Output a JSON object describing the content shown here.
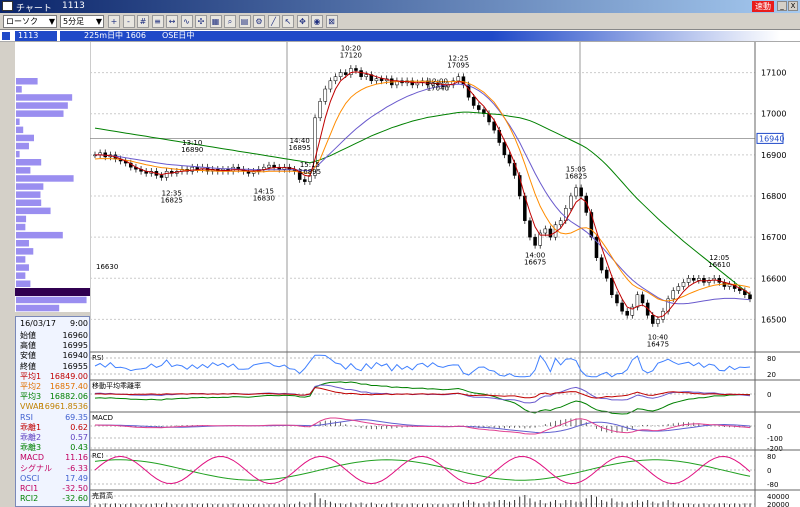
{
  "window": {
    "title": "チャート",
    "code": "1113",
    "fast_badge": "速動",
    "min_btn": "_",
    "close_btn": "X"
  },
  "toolbar": {
    "chart_type": "ローソク",
    "period": "5分足",
    "dropdown_arrow": "▼",
    "tools": [
      {
        "name": "zoom-in",
        "glyph": "+"
      },
      {
        "name": "zoom-out",
        "glyph": "-"
      },
      {
        "name": "grid",
        "glyph": "#"
      },
      {
        "name": "bars",
        "glyph": "≡"
      },
      {
        "name": "fit",
        "glyph": "↔"
      },
      {
        "name": "line-chart",
        "glyph": "∿"
      },
      {
        "name": "scatter",
        "glyph": "✣"
      },
      {
        "name": "table",
        "glyph": "▦"
      },
      {
        "name": "search",
        "glyph": "⌕"
      },
      {
        "name": "analysis",
        "glyph": "▤"
      },
      {
        "name": "settings",
        "glyph": "⚙"
      },
      {
        "name": "draw-line",
        "glyph": "╱"
      },
      {
        "name": "cursor",
        "glyph": "↖"
      },
      {
        "name": "pan",
        "glyph": "✥"
      },
      {
        "name": "find",
        "glyph": "◉"
      },
      {
        "name": "clear",
        "glyph": "⊠"
      }
    ]
  },
  "status": {
    "code": "1113",
    "symbol": "225m日中 1606",
    "market": "OSE日中"
  },
  "info_panel": {
    "date": "16/03/17",
    "time": "9:00",
    "rows": [
      {
        "label": "始値",
        "value": "16960",
        "color": "#000000"
      },
      {
        "label": "高値",
        "value": "16995",
        "color": "#000000"
      },
      {
        "label": "安値",
        "value": "16940",
        "color": "#000000"
      },
      {
        "label": "終値",
        "value": "16955",
        "color": "#000000"
      },
      {
        "label": "平均1",
        "value": "16849.00",
        "color": "#c00000"
      },
      {
        "label": "平均2",
        "value": "16857.40",
        "color": "#e07000"
      },
      {
        "label": "平均3",
        "value": "16882.06",
        "color": "#008000"
      },
      {
        "label": "VWAP",
        "value": "16961.8536",
        "color": "#c08000"
      },
      {
        "label": "RSI",
        "value": "69.35",
        "color": "#4060d0"
      },
      {
        "label": "乖離1",
        "value": "0.62",
        "color": "#c00000"
      },
      {
        "label": "乖離2",
        "value": "0.57",
        "color": "#6040c0"
      },
      {
        "label": "乖離3",
        "value": "0.43",
        "color": "#008000"
      },
      {
        "label": "MACD",
        "value": "11.16",
        "color": "#c00060"
      },
      {
        "label": "シグナル",
        "value": "-6.33",
        "color": "#c00060"
      },
      {
        "label": "OSCI",
        "value": "17.49",
        "color": "#4060d0"
      },
      {
        "label": "RCI1",
        "value": "-32.50",
        "color": "#c00060"
      },
      {
        "label": "RCI2",
        "value": "-32.60",
        "color": "#008000"
      }
    ]
  },
  "vol_profile": {
    "price_marker": "16630",
    "bars": [
      {
        "width": 0.3
      },
      {
        "width": 0.08
      },
      {
        "width": 0.78
      },
      {
        "width": 0.72
      },
      {
        "width": 0.66
      },
      {
        "width": 0.05
      },
      {
        "width": 0.1
      },
      {
        "width": 0.25
      },
      {
        "width": 0.18
      },
      {
        "width": 0.05
      },
      {
        "width": 0.35
      },
      {
        "width": 0.2
      },
      {
        "width": 0.8
      },
      {
        "width": 0.38
      },
      {
        "width": 0.34
      },
      {
        "width": 0.35
      },
      {
        "width": 0.48
      },
      {
        "width": 0.14
      },
      {
        "width": 0.13
      },
      {
        "width": 0.65
      },
      {
        "width": 0.18
      },
      {
        "width": 0.24
      },
      {
        "width": 0.13
      },
      {
        "width": 0.18
      },
      {
        "width": 0.13
      },
      {
        "width": 0.2
      },
      {
        "width": 0.98
      },
      {
        "width": 0.98
      },
      {
        "width": 0.6
      }
    ]
  },
  "colors": {
    "ma1": "#c00000",
    "ma2": "#ff8c00",
    "ma3": "#008000",
    "vwap": "#6a5acd",
    "candle_up": "#ffffff",
    "candle_down": "#000000",
    "rsi": "#4080ff",
    "macd": "#e04090",
    "signal": "#6060d0",
    "rci1": "#e01080",
    "rci2": "#20a020"
  },
  "price_axis": {
    "ticks": [
      "17100",
      "17000",
      "16900",
      "16800",
      "16700",
      "16600",
      "16500"
    ],
    "current": "16940"
  },
  "sub_panels": {
    "rsi": {
      "label": "RSI",
      "ticks": [
        "80",
        "20"
      ]
    },
    "dev": {
      "label": "移動平均乖離率",
      "ticks": [
        "0"
      ]
    },
    "macd": {
      "label": "MACD",
      "ticks": [
        "0",
        "-100",
        "-200"
      ]
    },
    "rci": {
      "label": "RCI",
      "ticks": [
        "80",
        "0",
        "-80"
      ]
    },
    "vol": {
      "label": "売買高",
      "ticks": [
        "40000",
        "20000"
      ]
    }
  },
  "chart_data": {
    "type": "candlestick",
    "ylim": [
      16450,
      17150
    ],
    "annotations": [
      {
        "time": "13:10",
        "price": "16890"
      },
      {
        "time": "12:35",
        "price": "16825"
      },
      {
        "time": "14:15",
        "price": "16830"
      },
      {
        "time": "14:40",
        "price": "16895"
      },
      {
        "time": "15:15",
        "price": "16895"
      },
      {
        "time": "10:20",
        "price": "17120"
      },
      {
        "time": "12:25",
        "price": "17095"
      },
      {
        "time": "12:00",
        "price": "17040"
      },
      {
        "time": "14:00",
        "price": "16675"
      },
      {
        "time": "15:05",
        "price": "16825"
      },
      {
        "time": "12:05",
        "price": "16610"
      },
      {
        "time": "10:40",
        "price": "16475"
      }
    ],
    "closes": [
      16900,
      16905,
      16895,
      16900,
      16890,
      16885,
      16880,
      16870,
      16865,
      16860,
      16855,
      16860,
      16850,
      16845,
      16860,
      16855,
      16860,
      16865,
      16860,
      16870,
      16865,
      16870,
      16860,
      16865,
      16860,
      16865,
      16860,
      16870,
      16865,
      16860,
      16855,
      16860,
      16865,
      16870,
      16875,
      16870,
      16865,
      16870,
      16865,
      16860,
      16840,
      16835,
      16850,
      16990,
      17030,
      17060,
      17080,
      17090,
      17100,
      17095,
      17110,
      17105,
      17090,
      17095,
      17080,
      17085,
      17080,
      17085,
      17070,
      17080,
      17075,
      17080,
      17070,
      17075,
      17080,
      17070,
      17075,
      17070,
      17065,
      17070,
      17080,
      17090,
      17070,
      17040,
      17020,
      17010,
      17000,
      16980,
      16960,
      16930,
      16900,
      16880,
      16850,
      16800,
      16740,
      16700,
      16680,
      16710,
      16720,
      16700,
      16730,
      16740,
      16770,
      16800,
      16820,
      16800,
      16760,
      16700,
      16650,
      16620,
      16600,
      16560,
      16540,
      16520,
      16510,
      16530,
      16560,
      16540,
      16510,
      16490,
      16500,
      16520,
      16550,
      16570,
      16580,
      16590,
      16600,
      16595,
      16600,
      16590,
      16595,
      16600,
      16590,
      16580,
      16585,
      16575,
      16570,
      16560,
      16550
    ],
    "ma1": [
      16900,
      16900,
      16899,
      16898,
      16895,
      16890,
      16885,
      16878,
      16870,
      16865,
      16860,
      16858,
      16855,
      16852,
      16855,
      16856,
      16858,
      16860,
      16861,
      16863,
      16864,
      16866,
      16865,
      16864,
      16863,
      16862,
      16862,
      16864,
      16864,
      16863,
      16861,
      16861,
      16862,
      16864,
      16867,
      16869,
      16869,
      16869,
      16868,
      16866,
      16858,
      16850,
      16848,
      16890,
      16940,
      16990,
      17030,
      17060,
      17080,
      17090,
      17100,
      17102,
      17100,
      17098,
      17094,
      17090,
      17086,
      17084,
      17080,
      17080,
      17078,
      17078,
      17076,
      17075,
      17076,
      17074,
      17074,
      17073,
      17071,
      17070,
      17072,
      17078,
      17076,
      17060,
      17045,
      17030,
      17018,
      17000,
      16985,
      16960,
      16935,
      16910,
      16880,
      16845,
      16800,
      16760,
      16725,
      16705,
      16705,
      16705,
      16712,
      16722,
      16740,
      16762,
      16785,
      16795,
      16785,
      16755,
      16715,
      16675,
      16640,
      16605,
      16575,
      16550,
      16530,
      16525,
      16532,
      16535,
      16527,
      16512,
      16505,
      16508,
      16520,
      16535,
      16552,
      16568,
      16580,
      16588,
      16594,
      16594,
      16594,
      16596,
      16594,
      16590,
      16587,
      16582,
      16576,
      16570,
      16562
    ],
    "ma2": [
      16890,
      16891,
      16891,
      16891,
      16890,
      16889,
      16887,
      16885,
      16882,
      16879,
      16876,
      16874,
      16871,
      16869,
      16868,
      16866,
      16865,
      16864,
      16863,
      16863,
      16862,
      16862,
      16861,
      16861,
      16860,
      16860,
      16860,
      16860,
      16860,
      16860,
      16860,
      16859,
      16859,
      16859,
      16860,
      16860,
      16860,
      16860,
      16860,
      16860,
      16858,
      16856,
      16855,
      16870,
      16890,
      16920,
      16950,
      16980,
      17005,
      17025,
      17040,
      17050,
      17058,
      17064,
      17068,
      17072,
      17074,
      17076,
      17077,
      17078,
      17078,
      17079,
      17079,
      17079,
      17079,
      17079,
      17079,
      17078,
      17078,
      17078,
      17078,
      17079,
      17078,
      17074,
      17068,
      17060,
      17052,
      17040,
      17028,
      17010,
      16990,
      16968,
      16942,
      16912,
      16878,
      16840,
      16805,
      16775,
      16752,
      16732,
      16718,
      16710,
      16708,
      16710,
      16716,
      16722,
      16723,
      16718,
      16706,
      16690,
      16672,
      16652,
      16632,
      16614,
      16598,
      16585,
      16577,
      16572,
      16566,
      16558,
      16550,
      16546,
      16545,
      16547,
      16551,
      16556,
      16562,
      16567,
      16572,
      16576,
      16580,
      16583,
      16585,
      16586,
      16586,
      16585,
      16583,
      16581,
      16578
    ],
    "ma3": [
      16965,
      16963,
      16961,
      16959,
      16957,
      16955,
      16953,
      16951,
      16949,
      16947,
      16945,
      16943,
      16941,
      16939,
      16937,
      16935,
      16933,
      16931,
      16929,
      16927,
      16925,
      16923,
      16921,
      16919,
      16917,
      16915,
      16913,
      16911,
      16909,
      16907,
      16905,
      16903,
      16901,
      16899,
      16897,
      16895,
      16893,
      16891,
      16889,
      16887,
      16885,
      16883,
      16881,
      16884,
      16888,
      16893,
      16898,
      16904,
      16910,
      16916,
      16922,
      16928,
      16934,
      16940,
      16946,
      16951,
      16956,
      16961,
      16966,
      16970,
      16974,
      16978,
      16982,
      16985,
      16988,
      16991,
      16993,
      16995,
      16997,
      16999,
      17001,
      17003,
      17004,
      17004,
      17003,
      17002,
      17001,
      17000,
      16999,
      16998,
      16996,
      16994,
      16992,
      16990,
      16987,
      16983,
      16978,
      16972,
      16966,
      16960,
      16954,
      16948,
      16942,
      16936,
      16930,
      16924,
      16917,
      16908,
      16898,
      16887,
      16875,
      16862,
      16848,
      16834,
      16820,
      16806,
      16793,
      16781,
      16769,
      16757,
      16745,
      16734,
      16723,
      16712,
      16701,
      16690,
      16680,
      16670,
      16660,
      16650,
      16640,
      16630,
      16620,
      16610,
      16600,
      16590,
      16580,
      16570,
      16560
    ],
    "vwap": [
      16900,
      16900,
      16899,
      16898,
      16897,
      16895,
      16893,
      16891,
      16889,
      16887,
      16885,
      16883,
      16881,
      16879,
      16877,
      16876,
      16875,
      16874,
      16873,
      16872,
      16871,
      16870,
      16869,
      16868,
      16867,
      16866,
      16866,
      16866,
      16865,
      16865,
      16865,
      16864,
      16864,
      16864,
      16864,
      16864,
      16864,
      16864,
      16864,
      16864,
      16863,
      16862,
      16862,
      16870,
      16880,
      16892,
      16904,
      16916,
      16928,
      16940,
      16952,
      16963,
      16973,
      16983,
      16992,
      17000,
      17008,
      17016,
      17023,
      17030,
      17036,
      17042,
      17047,
      17052,
      17056,
      17060,
      17063,
      17066,
      17068,
      17070,
      17071,
      17072,
      17071,
      17068,
      17063,
      17056,
      17047,
      17036,
      17023,
      17007,
      16990,
      16972,
      16952,
      16930,
      16905,
      16880,
      16855,
      16832,
      16811,
      16792,
      16775,
      16760,
      16748,
      16738,
      16730,
      16722,
      16713,
      16702,
      16690,
      16677,
      16663,
      16649,
      16635,
      16621,
      16608,
      16596,
      16586,
      16577,
      16569,
      16561,
      16553,
      16547,
      16542,
      16539,
      16538,
      16538,
      16539,
      16541,
      16543,
      16545,
      16547,
      16549,
      16550,
      16551,
      16551,
      16551,
      16550,
      16549,
      16548
    ]
  }
}
